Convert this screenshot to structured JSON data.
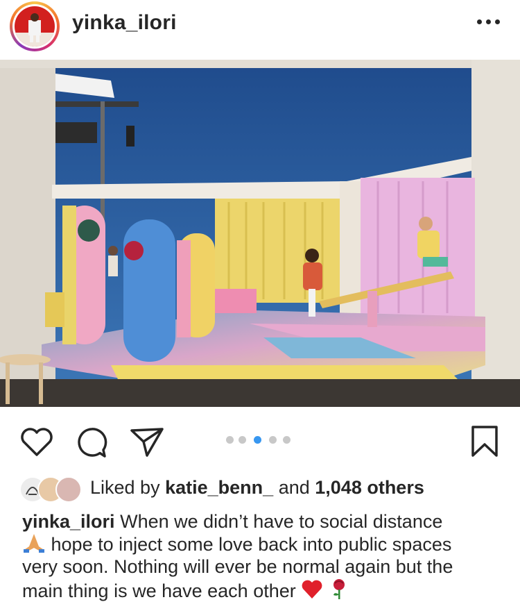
{
  "post": {
    "username": "yinka_ilori",
    "more_label": "More options"
  },
  "carousel": {
    "count": 5,
    "active_index": 2
  },
  "likes": {
    "prefix": "Liked by",
    "liked_by_user": "katie_benn_",
    "connector": "and",
    "others": "1,048 others"
  },
  "caption": {
    "username": "yinka_ilori",
    "line1": "When we didn’t have to social distance",
    "line2": "hope to inject some love back into public spaces",
    "line3": "very soon. Nothing will ever be normal again but the",
    "line4": "main thing is we have each other",
    "emojis": [
      "folded-hands",
      "red-heart",
      "rose"
    ]
  },
  "colors": {
    "story_ring": "#d62f6f",
    "carousel_active": "#3897f0",
    "text": "#262626"
  }
}
